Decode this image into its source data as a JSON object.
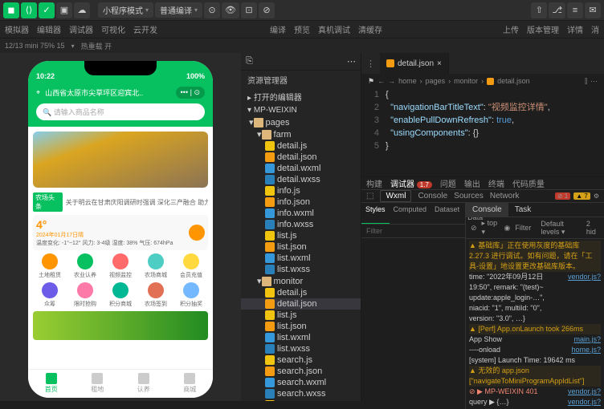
{
  "topbar": {
    "mode_dropdown": "小程序模式",
    "compile_dropdown": "普通编译"
  },
  "topbar2": {
    "left": [
      "模拟器",
      "编辑器",
      "调试器",
      "可视化",
      "云开发"
    ],
    "mid": [
      "编译",
      "预览",
      "真机调试",
      "清缓存"
    ],
    "right": [
      "上传",
      "版本管理",
      "详情",
      "消"
    ]
  },
  "statusbar": {
    "device": "12/13 mini 75% 15",
    "hot": "热重载 开"
  },
  "phone": {
    "time": "10:22",
    "battery": "100%",
    "location": "山西省太原市尖草坪区迎宾北..",
    "search_placeholder": "请输入商品名称",
    "news_tag": "农场头条",
    "news_text": "关于明云在甘肃庆阳调研时强调 深化三产融合 助力..",
    "temp": "4°",
    "date": "2024年01月17日晴",
    "weather_detail": "温度变化: -1°~12°  风力: 3-4级  湿度: 38%  气压: 674hPa",
    "grid1": [
      "土地租赁",
      "农业认养",
      "视频监控",
      "农场商城",
      "会员充值"
    ],
    "grid2": [
      "众筹",
      "限时抢购",
      "积分商城",
      "农场签到",
      "积分抽奖"
    ],
    "tabs": [
      "首页",
      "租地",
      "认养",
      "商城"
    ]
  },
  "explorer": {
    "title": "资源管理器",
    "open_editors": "打开的编辑器",
    "project": "MP-WEIXIN",
    "tree": [
      {
        "d": 1,
        "t": "folder",
        "n": "pages"
      },
      {
        "d": 2,
        "t": "folder",
        "n": "farm"
      },
      {
        "d": 3,
        "t": "js",
        "n": "detail.js"
      },
      {
        "d": 3,
        "t": "json",
        "n": "detail.json"
      },
      {
        "d": 3,
        "t": "wxml",
        "n": "detail.wxml"
      },
      {
        "d": 3,
        "t": "wxss",
        "n": "detail.wxss"
      },
      {
        "d": 3,
        "t": "js",
        "n": "info.js"
      },
      {
        "d": 3,
        "t": "json",
        "n": "info.json"
      },
      {
        "d": 3,
        "t": "wxml",
        "n": "info.wxml"
      },
      {
        "d": 3,
        "t": "wxss",
        "n": "info.wxss"
      },
      {
        "d": 3,
        "t": "js",
        "n": "list.js"
      },
      {
        "d": 3,
        "t": "json",
        "n": "list.json"
      },
      {
        "d": 3,
        "t": "wxml",
        "n": "list.wxml"
      },
      {
        "d": 3,
        "t": "wxss",
        "n": "list.wxss"
      },
      {
        "d": 2,
        "t": "folder",
        "n": "monitor"
      },
      {
        "d": 3,
        "t": "js",
        "n": "detail.js"
      },
      {
        "d": 3,
        "t": "json",
        "n": "detail.json",
        "sel": true
      },
      {
        "d": 3,
        "t": "js",
        "n": "list.js"
      },
      {
        "d": 3,
        "t": "json",
        "n": "list.json"
      },
      {
        "d": 3,
        "t": "wxml",
        "n": "list.wxml"
      },
      {
        "d": 3,
        "t": "wxss",
        "n": "list.wxss"
      },
      {
        "d": 3,
        "t": "js",
        "n": "search.js"
      },
      {
        "d": 3,
        "t": "json",
        "n": "search.json"
      },
      {
        "d": 3,
        "t": "wxml",
        "n": "search.wxml"
      },
      {
        "d": 3,
        "t": "wxss",
        "n": "search.wxss"
      },
      {
        "d": 3,
        "t": "js",
        "n": "about.js"
      }
    ]
  },
  "editor": {
    "tab_name": "detail.json",
    "crumb": [
      "home",
      "pages",
      "monitor",
      "detail.json"
    ],
    "code": {
      "k1": "\"navigationBarTitleText\"",
      "v1": "\"视频监控详情\"",
      "k2": "\"enablePullDownRefresh\"",
      "v2": "true",
      "k3": "\"usingComponents\"",
      "v3": "{}"
    }
  },
  "devtools": {
    "tabs": [
      "构建",
      "调试器",
      "问题",
      "输出",
      "终端",
      "代码质量"
    ],
    "badge": "1.7",
    "subtabs": [
      "Wxml",
      "Console",
      "Sources",
      "Network"
    ],
    "err_count": "1",
    "warn_count": "7",
    "styles_tabs": [
      "Styles",
      "Computed",
      "Dataset",
      "Component Data"
    ],
    "filter": "Filter",
    "console_tabs": [
      "Console",
      "Task"
    ],
    "console_top": "top",
    "console_filter": "Filter",
    "console_levels": "Default levels",
    "console_hidden": "2 hid",
    "lines": [
      {
        "cls": "warn",
        "txt": "▲ 基础库」正在使用灰度的基础库 2.27.3 进行调试。如有问题，请在「工具-设置」地设置更改基础库版本。"
      },
      {
        "cls": "",
        "txt": "  time: \"2022年09月12日 19:50\", remark: \"(test)~ update:apple_login-…\", niacid: \"1\", multiId: \"0\", version: \"3.0\", …}",
        "src": "vendor.js?"
      },
      {
        "cls": "warn",
        "txt": "▲ [Perf] App.onLaunch took 266ms"
      },
      {
        "cls": "",
        "txt": "  App Show",
        "src": "main.js?"
      },
      {
        "cls": "",
        "txt": "  ----onload",
        "src": "home.js?"
      },
      {
        "cls": "",
        "txt": "  [system] Launch Time: 19642 ms"
      },
      {
        "cls": "warn",
        "txt": "▲ 无效的 app.json [\"navigateToMiniProgramAppIdList\"]"
      },
      {
        "cls": "err",
        "txt": "  ⊘ ▶ MP-WEIXIN 401",
        "src": "vendor.js?"
      },
      {
        "cls": "",
        "txt": "  query ▶ {…}",
        "src": "vendor.js?"
      }
    ]
  }
}
